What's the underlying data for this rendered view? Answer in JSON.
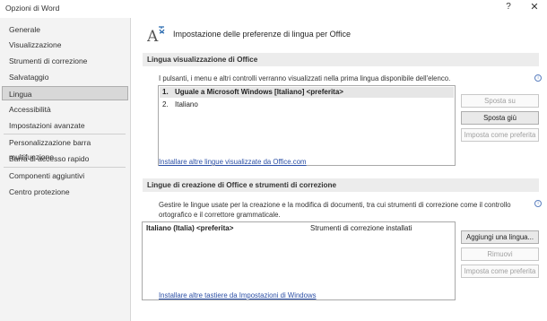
{
  "window": {
    "title": "Opzioni di Word",
    "help_label": "?",
    "close_label": "✕"
  },
  "sidebar": {
    "items": [
      {
        "label": "Generale"
      },
      {
        "label": "Visualizzazione"
      },
      {
        "label": "Strumenti di correzione"
      },
      {
        "label": "Salvataggio"
      },
      {
        "label": "Lingua"
      },
      {
        "label": "Accessibilità"
      },
      {
        "label": "Impostazioni avanzate"
      },
      {
        "label": "Personalizzazione barra multifunzione"
      },
      {
        "label": "Barra di accesso rapido"
      },
      {
        "label": "Componenti aggiuntivi"
      },
      {
        "label": "Centro protezione"
      }
    ],
    "selected": "Lingua"
  },
  "header": {
    "title": "Impostazione delle preferenze di lingua per Office",
    "icon": "language-icon"
  },
  "display_section": {
    "title": "Lingua visualizzazione di Office",
    "description": "I pulsanti, i menu e altri controlli verranno visualizzati nella prima lingua disponibile dell'elenco.",
    "languages": [
      {
        "index": "1.",
        "label": "Uguale a Microsoft Windows [Italiano] <preferita>",
        "selected": true
      },
      {
        "index": "2.",
        "label": "Italiano",
        "selected": false
      }
    ],
    "buttons": {
      "move_up": "Sposta su",
      "move_down": "Sposta giù",
      "set_preferred": "Imposta come preferita"
    },
    "link": "Installare altre lingue visualizzate da Office.com"
  },
  "authoring_section": {
    "title": "Lingue di creazione di Office e strumenti di correzione",
    "description_line1": "Gestire le lingue usate per la creazione e la modifica di documenti, tra cui strumenti di correzione come il controllo",
    "description_line2": "ortografico e il correttore grammaticale.",
    "rows": [
      {
        "language": "Italiano (Italia) <preferita>",
        "status": "Strumenti di correzione installati"
      }
    ],
    "buttons": {
      "add_language": "Aggiungi una lingua...",
      "remove": "Rimuovi",
      "set_preferred": "Imposta come preferita"
    },
    "link": "Installare altre tastiere da Impostazioni di Windows"
  },
  "colors": {
    "link": "#2b4fa6",
    "sidebar_bg": "#f3f3f3",
    "section_bg": "#ececec",
    "selected_item_bg": "#d8d8d8"
  }
}
